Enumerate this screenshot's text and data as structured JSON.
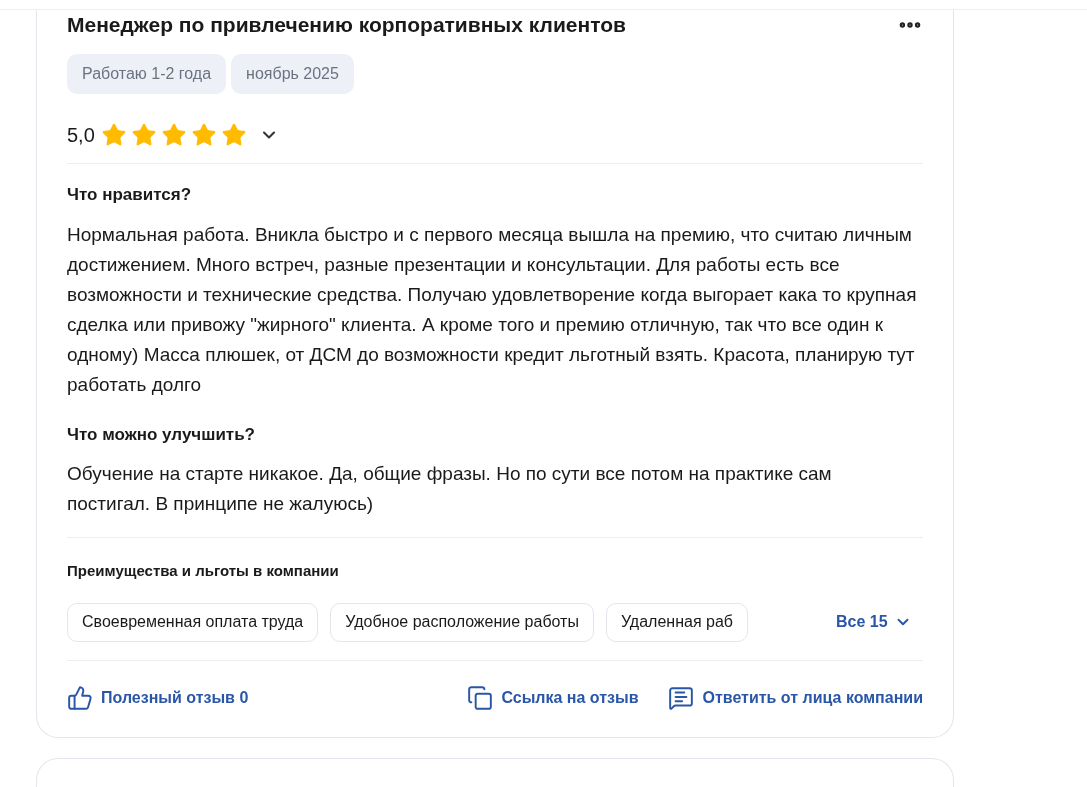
{
  "review": {
    "title": "Менеджер по привлечению корпоративных клиентов",
    "tags": [
      "Работаю 1-2 года",
      "ноябрь 2025"
    ],
    "rating": "5,0",
    "stars": 5,
    "sections": [
      {
        "heading": "Что нравится?",
        "text": "Нормальная работа. Вникла быстро и с первого месяца вышла на премию, что считаю личным достижением. Много встреч, разные презентации и консультации. Для работы есть все возможности и технические средства. Получаю удовлетворение когда выгорает кака то крупная сделка или привожу \"жирного\" клиента. А кроме того и премию отличную, так что все один к одному) Масса плюшек, от ДСМ до возможности кредит льготный взять. Красота, планирую тут работать долго"
      },
      {
        "heading": "Что можно улучшить?",
        "text": "Обучение на старте никакое. Да, общие фразы. Но по сути все потом на практике сам постигал. В принципе не жалуюсь)"
      }
    ],
    "benefits_heading": "Преимущества и льготы в компании",
    "benefits": [
      "Своевременная оплата труда",
      "Удобное расположение работы",
      "Удаленная раб"
    ],
    "benefits_more": "Все 15",
    "actions": [
      {
        "kind": "like",
        "label": "Полезный отзыв 0"
      },
      {
        "kind": "link",
        "label": "Ссылка на отзыв"
      },
      {
        "kind": "reply",
        "label": "Ответить от лица компании"
      }
    ]
  }
}
